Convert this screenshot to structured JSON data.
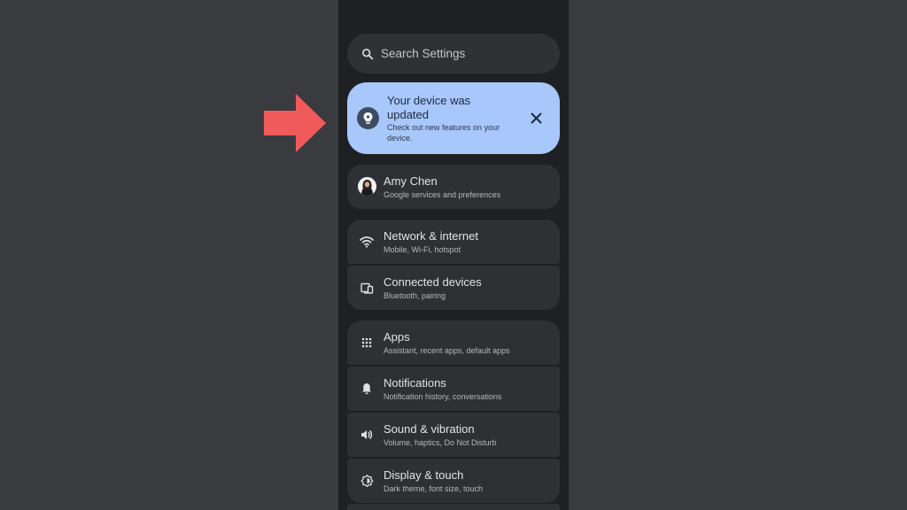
{
  "search": {
    "placeholder": "Search Settings"
  },
  "update_card": {
    "title": "Your device was updated",
    "subtitle": "Check out new features on your device."
  },
  "account": {
    "name": "Amy Chen",
    "description": "Google services and preferences"
  },
  "connectivity": [
    {
      "label": "Network & internet",
      "description": "Mobile, Wi-Fi, hotspot",
      "icon": "wifi-icon"
    },
    {
      "label": "Connected devices",
      "description": "Bluetooth, pairing",
      "icon": "connected-devices-icon"
    }
  ],
  "settings": [
    {
      "label": "Apps",
      "description": "Assistant, recent apps, default apps",
      "icon": "apps-grid-icon"
    },
    {
      "label": "Notifications",
      "description": "Notification history, conversations",
      "icon": "bell-icon"
    },
    {
      "label": "Sound & vibration",
      "description": "Volume, haptics, Do Not Disturb",
      "icon": "speaker-icon"
    },
    {
      "label": "Display & touch",
      "description": "Dark theme, font size, touch",
      "icon": "display-icon"
    }
  ],
  "colors": {
    "background": "#3a3b3f",
    "phone_background": "#1f2023",
    "card": "#2f3034",
    "update_card": "#a8c7fa",
    "arrow": "#f05a5a"
  }
}
